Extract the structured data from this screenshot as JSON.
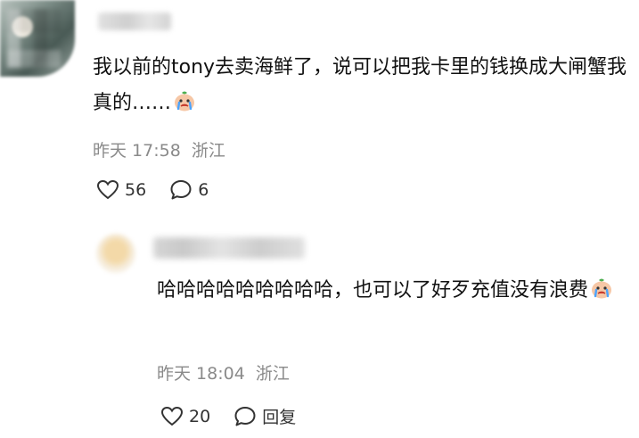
{
  "comment": {
    "text": "我以前的tony去卖海鲜了，说可以把我卡里的钱换成大闸蟹我真的……",
    "emoji": "crying-face-emoji",
    "time": "昨天 17:58",
    "location": "浙江",
    "like_count": "56",
    "reply_count": "6"
  },
  "reply": {
    "text": "哈哈哈哈哈哈哈哈哈，也可以了好歹充值没有浪费",
    "emoji": "crying-face-emoji",
    "time": "昨天 18:04",
    "location": "浙江",
    "like_count": "20",
    "reply_label": "回复"
  },
  "colors": {
    "text": "#111111",
    "meta": "#8a8a8a",
    "background": "#ffffff"
  }
}
